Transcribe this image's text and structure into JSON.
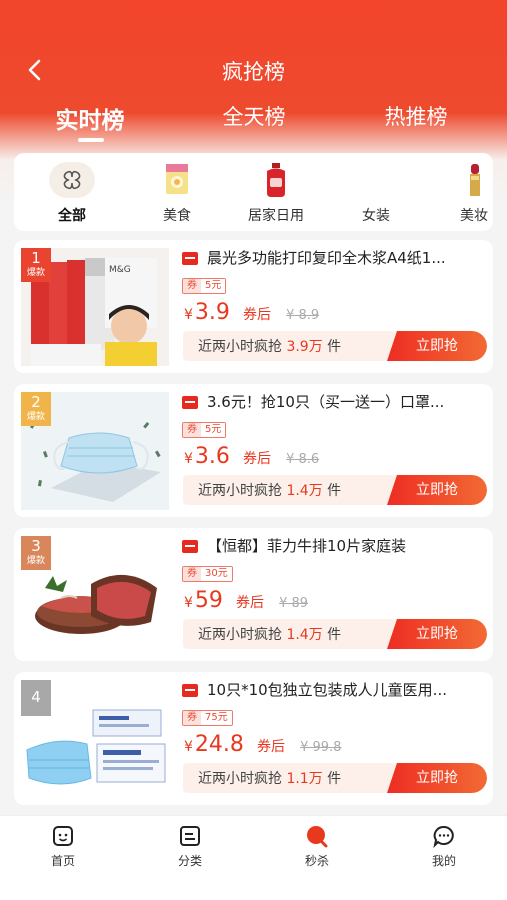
{
  "header": {
    "title": "疯抢榜",
    "tabs": [
      {
        "label": "实时榜",
        "active": true
      },
      {
        "label": "全天榜",
        "active": false
      },
      {
        "label": "热推榜",
        "active": false
      }
    ]
  },
  "categories": [
    {
      "label": "全部",
      "icon": "grid-icon",
      "active": true
    },
    {
      "label": "美食",
      "icon": "food-box-icon",
      "active": false
    },
    {
      "label": "居家日用",
      "icon": "detergent-bottle-icon",
      "active": false
    },
    {
      "label": "女装",
      "icon": "",
      "active": false
    },
    {
      "label": "美妆",
      "icon": "lipstick-icon",
      "active": false
    }
  ],
  "products": [
    {
      "rank": "1",
      "rank_tag": "爆款",
      "title": "晨光多功能打印复印全木浆A4纸1...",
      "coupon_prefix": "券",
      "coupon_value": "5元",
      "yen": "¥",
      "price": "3.9",
      "after_label": "券后",
      "original_price": "¥ 8.9",
      "sold_prefix": "近两小时疯抢",
      "sold_count": "3.9万",
      "sold_unit": "件",
      "button": "立即抢"
    },
    {
      "rank": "2",
      "rank_tag": "爆款",
      "title": "3.6元！抢10只（买一送一）口罩...",
      "coupon_prefix": "券",
      "coupon_value": "5元",
      "yen": "¥",
      "price": "3.6",
      "after_label": "券后",
      "original_price": "¥ 8.6",
      "sold_prefix": "近两小时疯抢",
      "sold_count": "1.4万",
      "sold_unit": "件",
      "button": "立即抢"
    },
    {
      "rank": "3",
      "rank_tag": "爆款",
      "title": "【恒都】菲力牛排10片家庭装",
      "coupon_prefix": "券",
      "coupon_value": "30元",
      "yen": "¥",
      "price": "59",
      "after_label": "券后",
      "original_price": "¥ 89",
      "sold_prefix": "近两小时疯抢",
      "sold_count": "1.4万",
      "sold_unit": "件",
      "button": "立即抢"
    },
    {
      "rank": "4",
      "rank_tag": "",
      "title": "10只*10包独立包装成人儿童医用...",
      "coupon_prefix": "券",
      "coupon_value": "75元",
      "yen": "¥",
      "price": "24.8",
      "after_label": "券后",
      "original_price": "¥ 99.8",
      "sold_prefix": "近两小时疯抢",
      "sold_count": "1.1万",
      "sold_unit": "件",
      "button": "立即抢"
    }
  ],
  "tabbar": [
    {
      "label": "首页",
      "icon": "home-face-icon",
      "active": false
    },
    {
      "label": "分类",
      "icon": "category-icon",
      "active": false
    },
    {
      "label": "秒杀",
      "icon": "flash-sale-icon",
      "active": true
    },
    {
      "label": "我的",
      "icon": "profile-chat-icon",
      "active": false
    }
  ],
  "colors": {
    "accent": "#ee3a24",
    "price": "#e8391f",
    "header_bg": "#f2452b"
  }
}
